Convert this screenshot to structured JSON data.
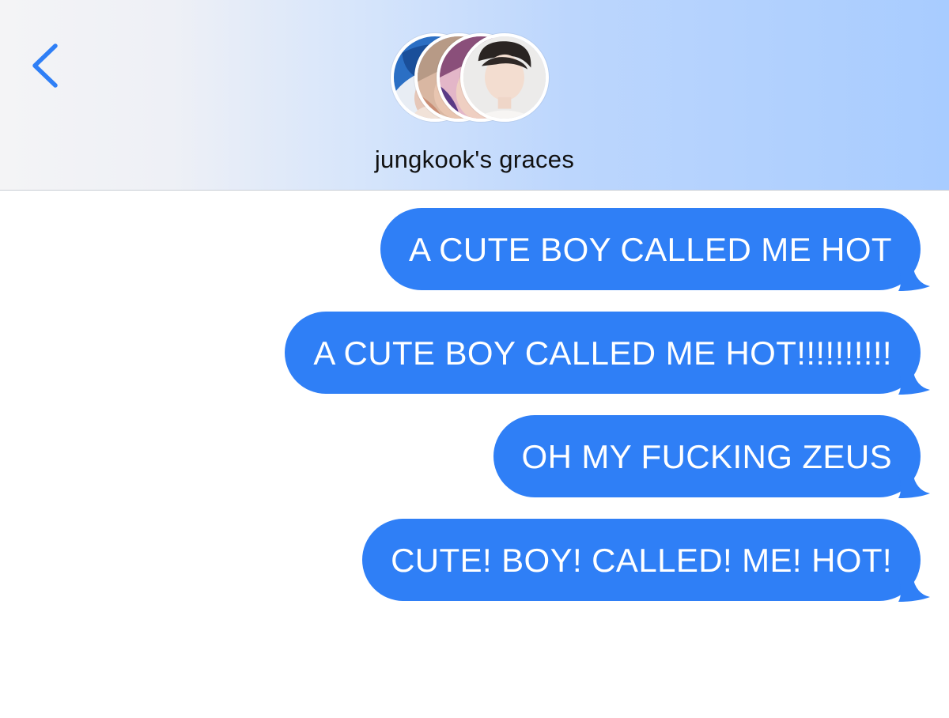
{
  "header": {
    "group_name": "jungkook's graces",
    "back_icon": "chevron-left-icon",
    "accent_color": "#2f7ff6"
  },
  "avatars": [
    {
      "icon": "member-avatar-1",
      "dominant_color": "#2b74c9"
    },
    {
      "icon": "member-avatar-2",
      "dominant_color": "#c9a48f"
    },
    {
      "icon": "member-avatar-3",
      "dominant_color": "#a85a86"
    },
    {
      "icon": "member-avatar-4",
      "dominant_color": "#e9e6e4"
    }
  ],
  "messages": [
    {
      "text": "A CUTE BOY CALLED ME HOT",
      "sender": "me"
    },
    {
      "text": "A CUTE BOY CALLED ME HOT!!!!!!!!!!",
      "sender": "me"
    },
    {
      "text": "OH MY FUCKING ZEUS",
      "sender": "me"
    },
    {
      "text": "CUTE! BOY! CALLED! ME! HOT!",
      "sender": "me"
    }
  ],
  "colors": {
    "bubble": "#2f7ff6",
    "bubble_text": "#ffffff",
    "header_gradient_end": "#a8ccff"
  }
}
